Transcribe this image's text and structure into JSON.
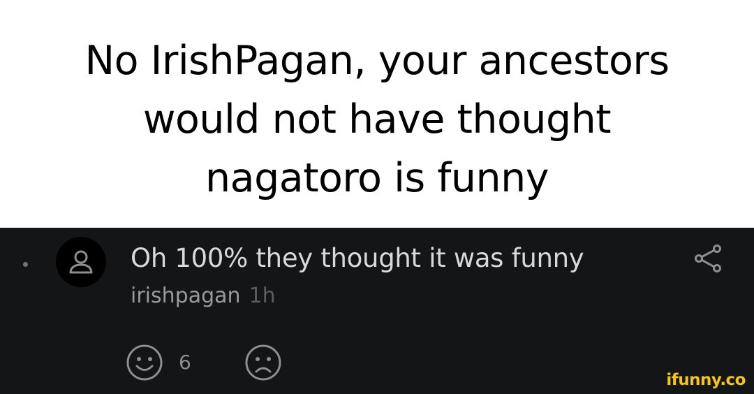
{
  "caption": {
    "lines": [
      "No IrishPagan, your ancestors",
      "would not have thought",
      "nagatoro is funny"
    ]
  },
  "comment": {
    "text": "Oh 100% they thought it was funny",
    "username": "irishpagan",
    "time": "1h",
    "smile_count": "6",
    "icons": {
      "avatar": "user-icon",
      "share": "share-icon",
      "smile": "smile-icon",
      "frown": "frown-icon"
    }
  },
  "watermark": "ifunny.co",
  "colors": {
    "caption_bg": "#ffffff",
    "caption_text": "#000000",
    "panel_bg": "#141517",
    "comment_text": "#d9d9d9",
    "username": "#9a9a9a",
    "time": "#5c5c5f",
    "icon_gray": "#8e8e8e",
    "watermark": "#f5c518"
  }
}
